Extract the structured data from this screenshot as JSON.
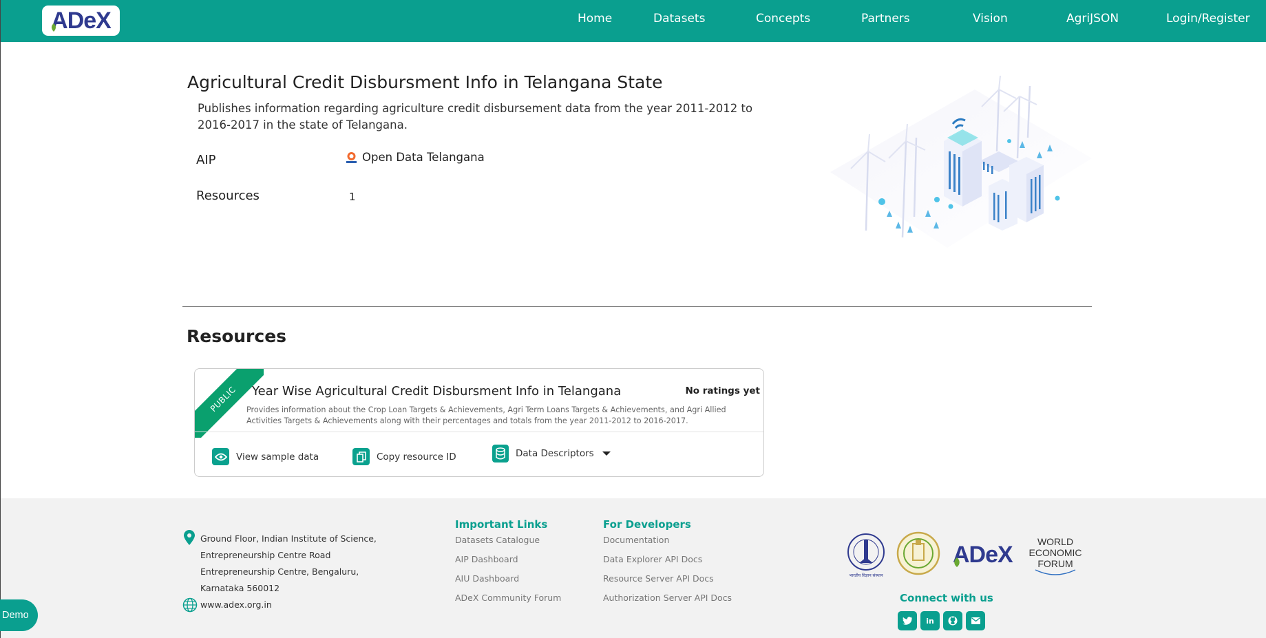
{
  "nav": {
    "logo": "ADeX",
    "links": [
      "Home",
      "Datasets",
      "Concepts",
      "Partners",
      "Vision",
      "AgriJSON",
      "Login/Register"
    ]
  },
  "dataset": {
    "title": "Agricultural Credit Disbursment Info in Telangana State",
    "description": "Publishes information regarding agriculture credit disbursement data from the year 2011-2012 to 2016-2017 in the state of Telangana.",
    "aip_label": "AIP",
    "aip_value": "Open Data Telangana",
    "resources_label": "Resources",
    "resources_value": "1"
  },
  "resources_section": {
    "title": "Resources",
    "card": {
      "ribbon": "PUBLIC",
      "title": "Year Wise Agricultural Credit Disbursment Info in Telangana",
      "ratings": "No ratings yet",
      "description": "Provides information about the Crop Loan Targets & Achievements, Agri Term Loans Targets & Achievements, and Agri Allied Activities Targets & Achievements along with their percentages and totals from the year 2011-2012 to 2016-2017.",
      "actions": {
        "view_sample": "View sample data",
        "copy_id": "Copy resource ID",
        "descriptors": "Data Descriptors"
      }
    }
  },
  "footer": {
    "address_lines": [
      "Ground Floor, Indian Institute of Science,",
      "Entrepreneurship Centre Road",
      "Entrepreneurship Centre, Bengaluru,",
      "Karnataka 560012"
    ],
    "website": "www.adex.org.in",
    "important_links": {
      "title": "Important Links",
      "items": [
        "Datasets Catalogue",
        "AIP Dashboard",
        "AIU Dashboard",
        "ADeX Community Forum"
      ]
    },
    "developers": {
      "title": "For Developers",
      "items": [
        "Documentation",
        "Data Explorer API Docs",
        "Resource Server API Docs",
        "Authorization Server API Docs"
      ]
    },
    "partner_logos": {
      "adex": "ADeX",
      "wef": [
        "WORLD",
        "ECONOMIC",
        "FORUM"
      ],
      "iisc_caption": "भारतीय विज्ञान संस्थान"
    },
    "connect_title": "Connect with us",
    "social": [
      "twitter-icon",
      "linkedin-icon",
      "github-icon",
      "mail-icon"
    ]
  },
  "demo_button": "Demo",
  "colors": {
    "brand": "#0a9f8f",
    "ribbon": "#0aa06e",
    "logo_blue": "#2f3a8f"
  }
}
